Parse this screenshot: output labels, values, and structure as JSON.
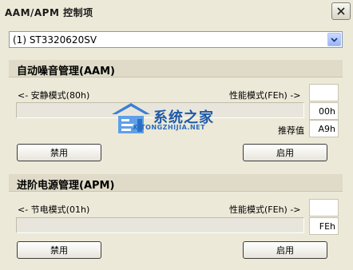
{
  "window": {
    "title": "AAM/APM 控制项"
  },
  "drive_select": {
    "selected": "(1) ST3320620SV"
  },
  "aam": {
    "title": "自动噪音管理(AAM)",
    "left_label": "<- 安静模式(80h)",
    "right_label": "性能模式(FEh) ->",
    "current_value": "00h",
    "recommended_label": "推荐值",
    "recommended_value": "A9h",
    "disable_label": "禁用",
    "enable_label": "启用"
  },
  "apm": {
    "title": "进阶电源管理(APM)",
    "left_label": "<- 节电模式(01h)",
    "right_label": "性能模式(FEh) ->",
    "current_value": "FEh",
    "disable_label": "禁用",
    "enable_label": "启用"
  },
  "watermark": {
    "title": "系统之家",
    "subtitle": "XITONGZHIJIA.NET"
  },
  "icons": {
    "close": "close-icon",
    "dropdown": "chevron-down-icon",
    "logo": "system-home-logo-icon"
  }
}
